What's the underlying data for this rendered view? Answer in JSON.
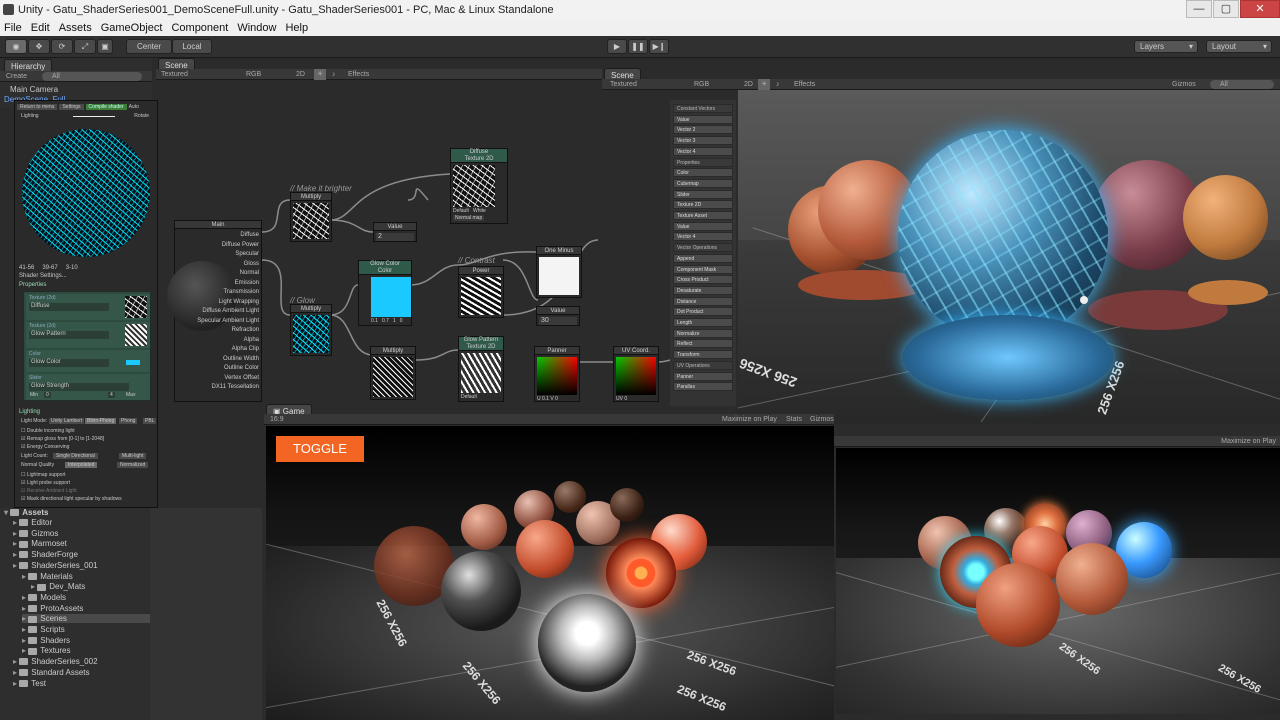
{
  "window": {
    "title": "Unity - Gatu_ShaderSeries001_DemoSceneFull.unity - Gatu_ShaderSeries001 - PC, Mac & Linux Standalone",
    "min": "—",
    "max": "▢",
    "close": "✕"
  },
  "menu": [
    "File",
    "Edit",
    "Assets",
    "GameObject",
    "Component",
    "Window",
    "Help"
  ],
  "toolbar": {
    "center": "Center",
    "local": "Local",
    "layers": "Layers",
    "layout": "Layout",
    "play": "▶",
    "pause": "❚❚",
    "step": "▶❙"
  },
  "hierarchy": {
    "tab": "Hierarchy",
    "create": "Create",
    "search": "All",
    "items": [
      "Main Camera",
      "DemoScene_Full"
    ]
  },
  "scene_small": {
    "tab": "Scene",
    "mode": "Textured",
    "rgb": "RGB",
    "dim": "2D",
    "effects": "Effects"
  },
  "scene_main": {
    "tab": "Scene",
    "mode": "Textured",
    "rgb": "RGB",
    "dim": "2D",
    "effects": "Effects",
    "gizmos": "Gizmos",
    "search": "All"
  },
  "shader_editor": {
    "top_buttons": [
      "Return to menu",
      "Settings",
      "Compile shader",
      "Auto"
    ],
    "preview_buttons": [
      "Lighting",
      "Rotate"
    ],
    "stats": [
      "41-56",
      "39-67",
      "3-10"
    ],
    "settings": "Shader Settings...",
    "properties_label": "Properties",
    "props": [
      {
        "type": "Texture (2d)",
        "name": "Diffuse"
      },
      {
        "type": "Texture (2d)",
        "name": "Glow Pattern"
      },
      {
        "type": "Color",
        "name": "Glow Color"
      },
      {
        "type": "Slider",
        "name": "Glow Strength",
        "min": "Min",
        "min_val": "0",
        "max_val": "4",
        "max": "Max"
      }
    ],
    "lighting_label": "Lighting",
    "light_mode": "Light Mode:",
    "light_modes": [
      "Unity Lambert",
      "Blinn-Phong",
      "Phong",
      "PBL"
    ],
    "checks": [
      "Double incoming light",
      "Remap gloss from [0-1] to [1-2048]",
      "Energy Conserving"
    ],
    "light_count": "Light Count:",
    "light_count_vals": [
      "Single Directional",
      "Multi-light"
    ],
    "normal_quality": "Normal Quality",
    "normal_quality_vals": [
      "Interpolated",
      "Normalized"
    ],
    "checks2": [
      "Lightmap support",
      "Light probe support",
      "Receive Ambient Light",
      "Mask directional light specular by shadows"
    ]
  },
  "nodes": {
    "main": {
      "title": "Main",
      "inputs": [
        "Diffuse",
        "Diffuse Power",
        "Specular",
        "Gloss",
        "Normal",
        "Emission",
        "Transmission",
        "Light Wrapping",
        "Diffuse Ambient Light",
        "Specular Ambient Light",
        "Refraction",
        "Alpha",
        "Alpha Clip",
        "Outline Width",
        "Outline Color",
        "Vertex Offset",
        "DX11 Tessellation"
      ]
    },
    "comment1": "// Make it brighter",
    "comment2": "// Glow",
    "comment3": "// Contrast",
    "multiply1": "Multiply",
    "value1": {
      "title": "Value",
      "val": "2"
    },
    "diffuse": {
      "title": "Diffuse",
      "sub": "Texture 2D",
      "tex": "Default",
      "white": "White",
      "normal": "Normal map"
    },
    "glow_color": {
      "title": "Glow Color",
      "sub": "Color",
      "vals": [
        "0.1",
        "0.7",
        "1",
        "0"
      ]
    },
    "glow_mult": "Multiply",
    "multiply2": "Multiply",
    "power": "Power",
    "one_minus": "One Minus",
    "value2": {
      "title": "Value",
      "val": "30"
    },
    "glow_pattern": {
      "title": "Glow Pattern",
      "sub": "Texture 2D",
      "tex": "Default"
    },
    "panner": {
      "title": "Panner",
      "u": "U 0.1",
      "v": "V 0"
    },
    "uv": {
      "title": "UV Coord.",
      "val": "UV 0"
    }
  },
  "node_list": [
    "Constant Vectors",
    "Value",
    "Vector 2",
    "Vector 3",
    "Vector 4",
    "Properties",
    "Color",
    "Cubemap",
    "Slider",
    "Texture 2D",
    "Texture Asset",
    "Value",
    "Vector 4",
    "Vector Operations",
    "Append",
    "Component Mask",
    "Cross Product",
    "Desaturate",
    "Distance",
    "Dot Product",
    "Length",
    "Normalize",
    "Reflect",
    "Transform",
    "UV Operations",
    "Panner",
    "Parallax"
  ],
  "project": {
    "root": "Assets",
    "items": [
      {
        "label": "Editor",
        "level": 1
      },
      {
        "label": "Gizmos",
        "level": 1
      },
      {
        "label": "Marmoset",
        "level": 1
      },
      {
        "label": "ShaderForge",
        "level": 1
      },
      {
        "label": "ShaderSeries_001",
        "level": 1
      },
      {
        "label": "Materials",
        "level": 2
      },
      {
        "label": "Dev_Mats",
        "level": 3
      },
      {
        "label": "Models",
        "level": 2
      },
      {
        "label": "ProtoAssets",
        "level": 2
      },
      {
        "label": "Scenes",
        "level": 2,
        "selected": true
      },
      {
        "label": "Scripts",
        "level": 2
      },
      {
        "label": "Shaders",
        "level": 2
      },
      {
        "label": "Textures",
        "level": 2
      },
      {
        "label": "ShaderSeries_002",
        "level": 1
      },
      {
        "label": "Standard Assets",
        "level": 1
      },
      {
        "label": "Test",
        "level": 1
      }
    ]
  },
  "game": {
    "tab": "Game",
    "aspect": "16:9",
    "maximize": "Maximize on Play",
    "stats": "Stats",
    "gizmos": "Gizmos",
    "toggle": "TOGGLE"
  },
  "game2": {
    "maximize": "Maximize on Play"
  },
  "floor_labels": {
    "scene": [
      "256 X256",
      "256 X256"
    ],
    "game": [
      "256 X256",
      "256 X256",
      "256 X256",
      "256 X256"
    ],
    "game2": [
      "256 X256",
      "256 X256"
    ]
  },
  "colors": {
    "accent": "#f26522",
    "cyan": "#19c9ff",
    "selection": "#3e5f96"
  }
}
